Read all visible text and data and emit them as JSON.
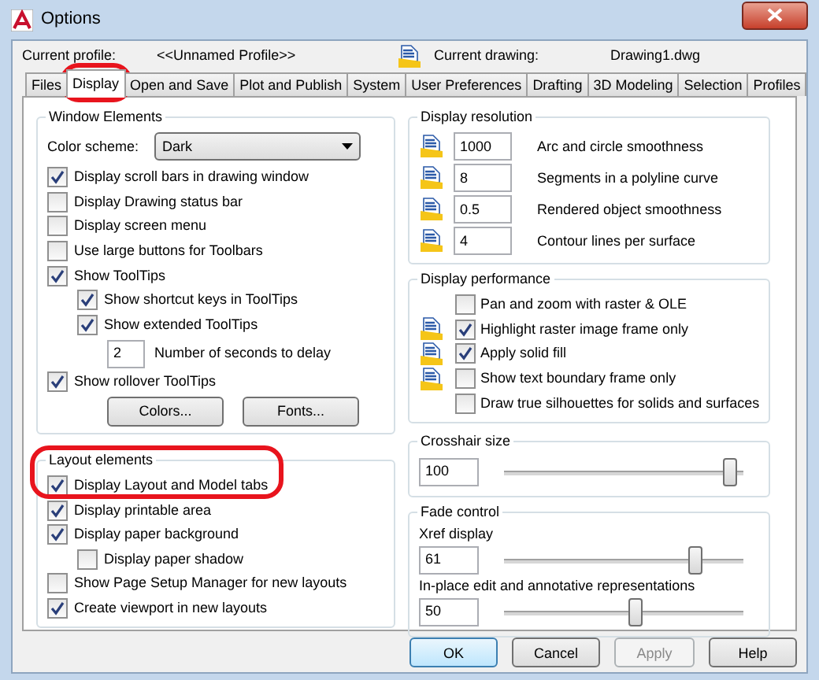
{
  "window": {
    "title": "Options"
  },
  "profile": {
    "label": "Current profile:",
    "value": "<<Unnamed Profile>>"
  },
  "drawing": {
    "label": "Current drawing:",
    "value": "Drawing1.dwg"
  },
  "tabs": [
    {
      "label": "Files",
      "selected": false
    },
    {
      "label": "Display",
      "selected": true
    },
    {
      "label": "Open and Save",
      "selected": false
    },
    {
      "label": "Plot and Publish",
      "selected": false
    },
    {
      "label": "System",
      "selected": false
    },
    {
      "label": "User Preferences",
      "selected": false
    },
    {
      "label": "Drafting",
      "selected": false
    },
    {
      "label": "3D Modeling",
      "selected": false
    },
    {
      "label": "Selection",
      "selected": false
    },
    {
      "label": "Profiles",
      "selected": false
    }
  ],
  "window_elements": {
    "title": "Window Elements",
    "color_scheme": {
      "label": "Color scheme:",
      "value": "Dark"
    },
    "items": [
      {
        "kind": "checkbox",
        "label": "Display scroll bars in drawing window",
        "checked": true
      },
      {
        "kind": "checkbox",
        "label": "Display Drawing status bar",
        "checked": false
      },
      {
        "kind": "checkbox",
        "label": "Display screen menu",
        "checked": false
      },
      {
        "kind": "checkbox",
        "label": "Use large buttons for Toolbars",
        "checked": false
      },
      {
        "kind": "checkbox",
        "label": "Show ToolTips",
        "checked": true,
        "children": [
          {
            "kind": "checkbox",
            "label": "Show shortcut keys in ToolTips",
            "checked": true
          },
          {
            "kind": "checkbox",
            "label": "Show extended ToolTips",
            "checked": true,
            "children": [
              {
                "kind": "number",
                "value": "2",
                "label": "Number of seconds to delay"
              }
            ]
          }
        ]
      },
      {
        "kind": "checkbox",
        "label": "Show rollover ToolTips",
        "checked": true
      }
    ],
    "buttons": [
      "Colors...",
      "Fonts..."
    ]
  },
  "layout_elements": {
    "title": "Layout elements",
    "items": [
      {
        "kind": "checkbox",
        "label": "Display Layout and Model tabs",
        "checked": true
      },
      {
        "kind": "checkbox",
        "label": "Display printable area",
        "checked": true
      },
      {
        "kind": "checkbox",
        "label": "Display paper background",
        "checked": true,
        "children": [
          {
            "kind": "checkbox",
            "label": "Display paper shadow",
            "checked": false
          }
        ]
      },
      {
        "kind": "checkbox",
        "label": "Show Page Setup Manager for new layouts",
        "checked": false
      },
      {
        "kind": "checkbox",
        "label": "Create viewport in new layouts",
        "checked": true
      }
    ]
  },
  "display_resolution": {
    "title": "Display resolution",
    "rows": [
      {
        "value": "1000",
        "label": "Arc and circle smoothness"
      },
      {
        "value": "8",
        "label": "Segments in a polyline curve"
      },
      {
        "value": "0.5",
        "label": "Rendered object smoothness"
      },
      {
        "value": "4",
        "label": "Contour lines per surface"
      }
    ]
  },
  "display_performance": {
    "title": "Display performance",
    "items": [
      {
        "label": "Pan and zoom with raster & OLE",
        "checked": false,
        "drawing_icon": false
      },
      {
        "label": "Highlight raster image frame only",
        "checked": true,
        "drawing_icon": true
      },
      {
        "label": "Apply solid fill",
        "checked": true,
        "drawing_icon": true
      },
      {
        "label": "Show text boundary frame only",
        "checked": false,
        "drawing_icon": true
      },
      {
        "label": "Draw true silhouettes for solids and surfaces",
        "checked": false,
        "drawing_icon": false
      }
    ]
  },
  "crosshair_size": {
    "title": "Crosshair size",
    "value": "100",
    "level": 0.97
  },
  "fade_control": {
    "title": "Fade control",
    "items": [
      {
        "label": "Xref display",
        "value": "61",
        "level": 0.82
      },
      {
        "label": "In-place edit and annotative representations",
        "value": "50",
        "level": 0.55
      }
    ]
  },
  "dialog_buttons": [
    {
      "label": "OK",
      "default": true,
      "disabled": false
    },
    {
      "label": "Cancel",
      "default": false,
      "disabled": false
    },
    {
      "label": "Apply",
      "default": false,
      "disabled": true
    },
    {
      "label": "Help",
      "default": false,
      "disabled": false
    }
  ]
}
